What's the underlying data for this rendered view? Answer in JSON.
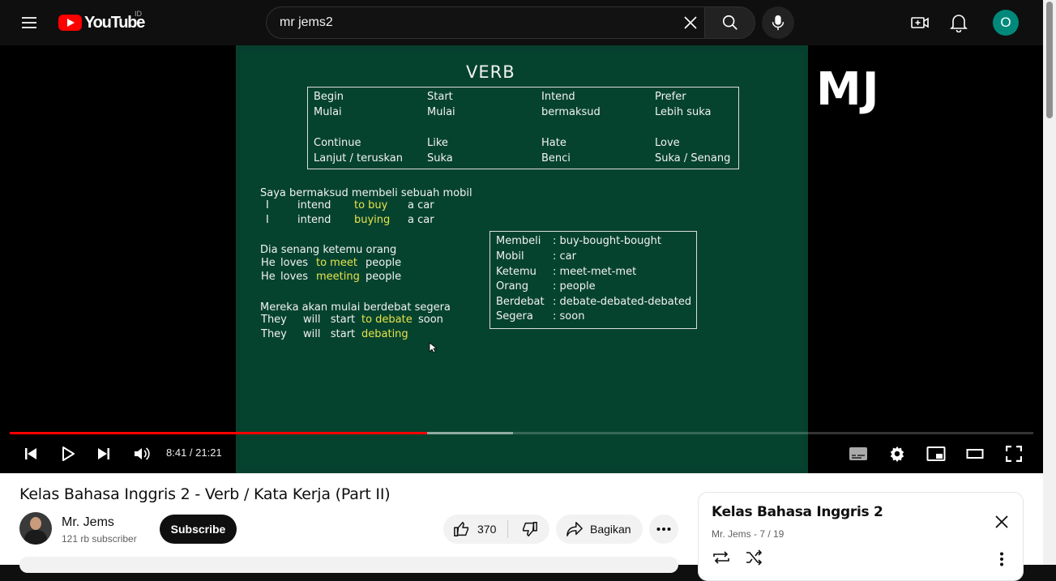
{
  "masthead": {
    "logo_text": "YouTube",
    "country_code": "ID",
    "search_value": "mr jems2",
    "avatar_letter": "O",
    "avatar_color": "#00897b"
  },
  "player": {
    "board": {
      "title": "VERB",
      "verbs": [
        {
          "en": "Begin",
          "id": "Mulai"
        },
        {
          "en": "Start",
          "id": "Mulai"
        },
        {
          "en": "Intend",
          "id": "bermaksud"
        },
        {
          "en": "Prefer",
          "id": "Lebih suka"
        },
        {
          "en": "Continue",
          "id": "Lanjut / teruskan"
        },
        {
          "en": "Like",
          "id": "Suka"
        },
        {
          "en": "Hate",
          "id": "Benci"
        },
        {
          "en": "Love",
          "id": "Suka / Senang"
        }
      ],
      "examples": [
        {
          "sentence": "Saya bermaksud membeli sebuah mobil",
          "rows": [
            {
              "subject": "I",
              "verb": "intend",
              "highlight": "to buy",
              "rest": "a car"
            },
            {
              "subject": "I",
              "verb": "intend",
              "highlight": "buying",
              "rest": "a car"
            }
          ]
        },
        {
          "sentence": "Dia senang ketemu orang",
          "rows": [
            {
              "subject": "He",
              "verb": "loves",
              "highlight": "to meet",
              "rest": "people"
            },
            {
              "subject": "He",
              "verb": "loves",
              "highlight": "meeting",
              "rest": "people"
            }
          ]
        },
        {
          "sentence": "Mereka akan mulai berdebat segera",
          "rows": [
            {
              "subject": "They",
              "verb": "will   start",
              "highlight": "to debate",
              "rest": "soon"
            },
            {
              "subject": "They",
              "verb": "will   start",
              "highlight": "debating",
              "rest": ""
            }
          ]
        }
      ],
      "vocab": [
        {
          "id": "Membeli",
          "en": ": buy-bought-bought"
        },
        {
          "id": "Mobil",
          "en": ": car"
        },
        {
          "id": "Ketemu",
          "en": ": meet-met-met"
        },
        {
          "id": "Orang",
          "en": ": people"
        },
        {
          "id": "Berdebat",
          "en": ": debate-debated-debated"
        },
        {
          "id": "Segera",
          "en": ": soon"
        }
      ],
      "highlight_color": "#e6e34a",
      "board_color": "#073f2e"
    },
    "watermark": "MJ",
    "progress": {
      "played_fraction": 0.408,
      "buffered_fraction": 0.492
    },
    "time": "8:41 / 21:21",
    "accent": "#ff0000"
  },
  "video": {
    "title": "Kelas Bahasa Inggris 2 - Verb / Kata Kerja (Part II)",
    "channel_name": "Mr. Jems",
    "subscribers": "121 rb subscriber",
    "subscribe_label": "Subscribe",
    "likes": "370",
    "share_label": "Bagikan"
  },
  "playlist": {
    "title": "Kelas Bahasa Inggris 2",
    "meta": "Mr. Jems - 7 / 19"
  }
}
